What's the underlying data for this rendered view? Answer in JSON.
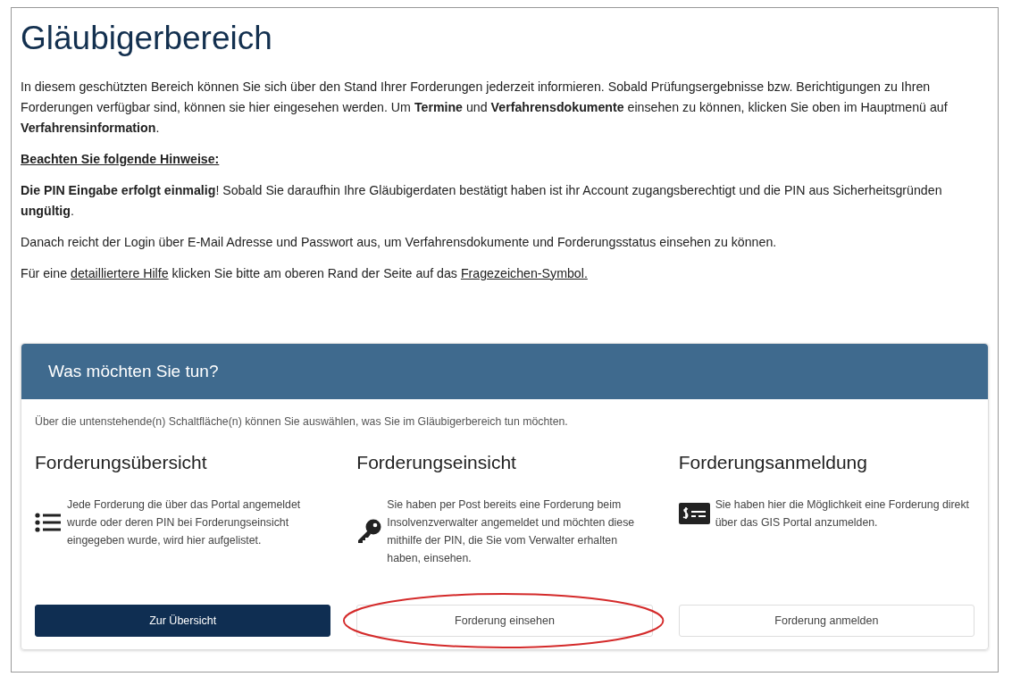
{
  "title": "Gläubigerbereich",
  "intro": "In diesem geschützten Bereich können Sie sich über den Stand Ihrer Forderungen jederzeit informieren. Sobald Prüfungsergebnisse bzw. Berichtigungen zu Ihren Forderungen verfügbar sind, können sie hier eingesehen werden. Um **Termine** und **Verfahrensdokumente** einsehen zu können, klicken Sie oben im Hauptmenü auf **Verfahrensinformation**.",
  "notice_heading": "Beachten Sie folgende Hinweise:",
  "notices": [
    {
      "parts": [
        {
          "text": "**Die PIN Eingabe erfolgt einmalig**! Sobald Sie daraufhin Ihre Gläubigerdaten bestätigt haben ist ihr Account zugangsberechtigt und die PIN aus Sicherheitsgründen **ungültig**."
        }
      ]
    },
    {
      "parts": [
        {
          "text": "Danach reicht der Login über E-Mail Adresse und Passwort aus, um Verfahrensdokumente und Forderungsstatus einsehen zu können."
        }
      ]
    },
    {
      "parts": [
        {
          "text": "Für eine "
        },
        {
          "link": "detailliertere Hilfe"
        },
        {
          "text": " klicken Sie bitte am oberen Rand der Seite auf das "
        },
        {
          "link": "Fragezeichen-Symbol."
        }
      ]
    }
  ],
  "panel": {
    "title": "Was möchten Sie tun?",
    "description": "Über die untenstehende(n) Schaltfläche(n) können Sie auswählen, was Sie im Gläubigerbereich tun möchten.",
    "actions": [
      {
        "heading": "Forderungsübersicht",
        "text": "Jede Forderung die über das Portal angemeldet wurde oder deren PIN bei Forderungseinsicht eingegeben wurde, wird hier aufgelistet.",
        "button": "Zur Übersicht",
        "primary": true,
        "highlighted": false
      },
      {
        "heading": "Forderungseinsicht",
        "text": "Sie haben per Post bereits eine Forderung beim Insolvenzverwalter angemeldet und möchten diese mithilfe der PIN, die Sie vom Verwalter erhalten haben, einsehen.",
        "button": "Forderung einsehen",
        "primary": false,
        "highlighted": true
      },
      {
        "heading": "Forderungsanmeldung",
        "text": "Sie haben hier die Möglichkeit eine Forderung direkt über das GIS Portal anzumelden.",
        "button": "Forderung anmelden",
        "primary": false,
        "highlighted": false
      }
    ]
  }
}
